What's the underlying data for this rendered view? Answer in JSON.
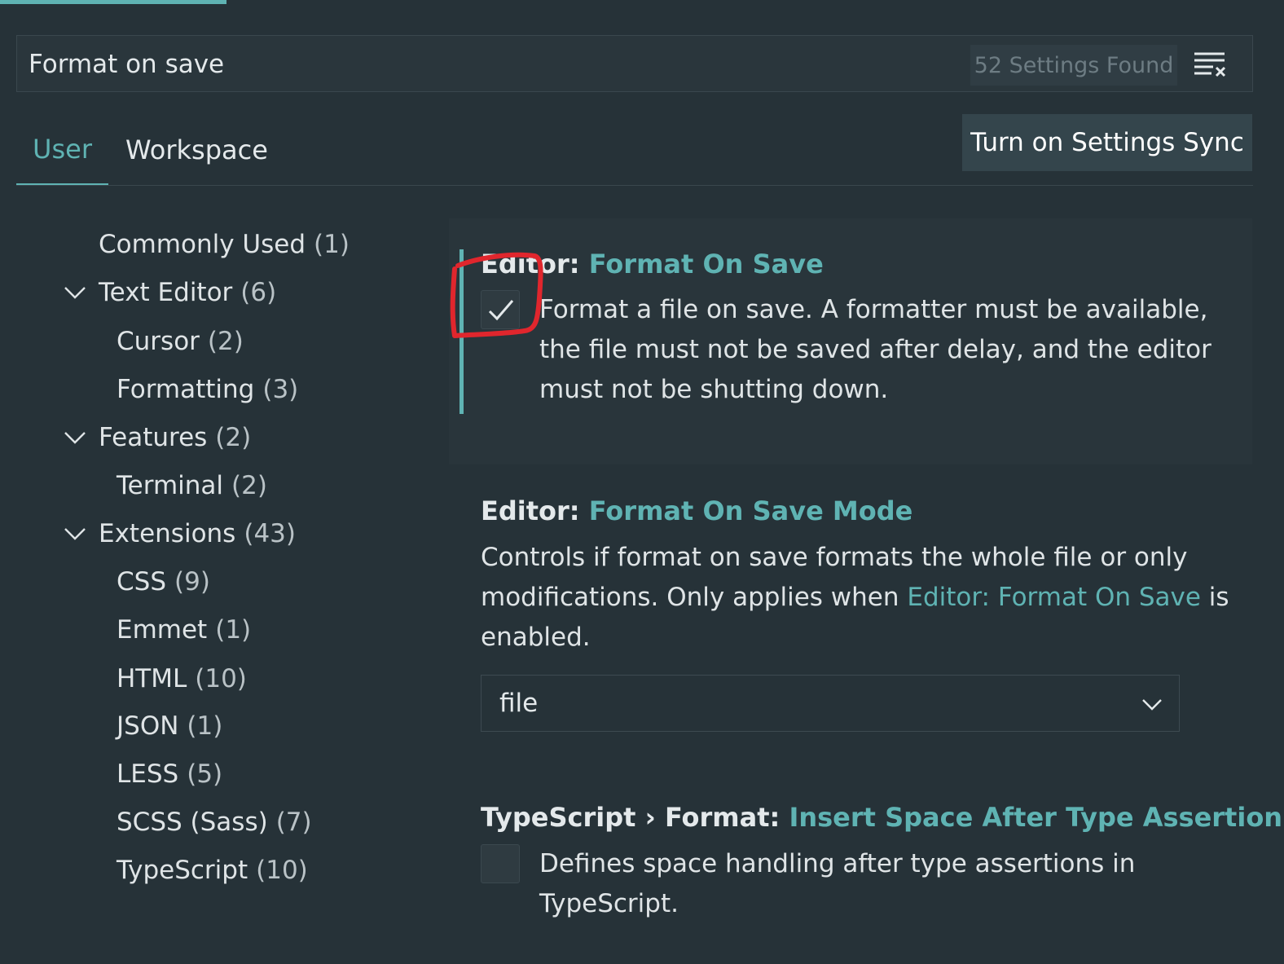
{
  "search": {
    "value": "Format on save",
    "results": "52 Settings Found"
  },
  "tabs": [
    {
      "label": "User",
      "active": true
    },
    {
      "label": "Workspace",
      "active": false
    }
  ],
  "sync_button": "Turn on Settings Sync",
  "toc": [
    {
      "label": "Commonly Used",
      "count": "(1)"
    },
    {
      "label": "Text Editor",
      "count": "(6)",
      "expanded": true
    },
    {
      "label": "Cursor",
      "count": "(2)"
    },
    {
      "label": "Formatting",
      "count": "(3)"
    },
    {
      "label": "Features",
      "count": "(2)",
      "expanded": true
    },
    {
      "label": "Terminal",
      "count": "(2)"
    },
    {
      "label": "Extensions",
      "count": "(43)",
      "expanded": true
    },
    {
      "label": "CSS",
      "count": "(9)"
    },
    {
      "label": "Emmet",
      "count": "(1)"
    },
    {
      "label": "HTML",
      "count": "(10)"
    },
    {
      "label": "JSON",
      "count": "(1)"
    },
    {
      "label": "LESS",
      "count": "(5)"
    },
    {
      "label": "SCSS (Sass)",
      "count": "(7)"
    },
    {
      "label": "TypeScript",
      "count": "(10)"
    }
  ],
  "settings": [
    {
      "category": "Editor: ",
      "key": "Format On Save",
      "checked": true,
      "description_lines": [
        "Format a file on save. A formatter must be available,",
        "the file must not be saved after delay, and the editor",
        "must not be shutting down."
      ]
    },
    {
      "category": "Editor: ",
      "key": "Format On Save Mode",
      "description_line1": "Controls if format on save formats the whole file or only",
      "description_line2_pre": "modifications. Only applies when ",
      "description_link": "Editor: Format On Save",
      "description_line2_post": " is",
      "description_line3": "enabled.",
      "select_value": "file"
    },
    {
      "category": "TypeScript › Format: ",
      "key": "Insert Space After Type Assertion",
      "checked": false,
      "description_lines": [
        "Defines space handling after type assertions in",
        "TypeScript."
      ]
    }
  ],
  "colors": {
    "background": "#263238",
    "accent": "#5fb3b3",
    "annotation": "#e0262d"
  }
}
